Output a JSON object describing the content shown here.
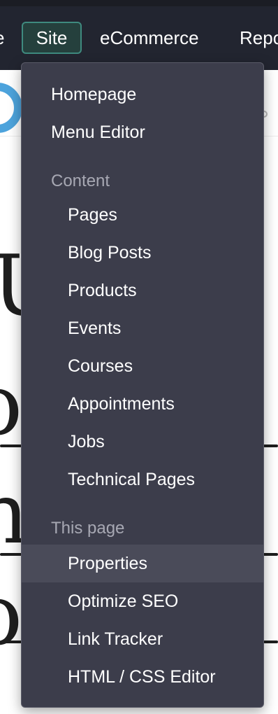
{
  "topnav": {
    "items": [
      "e",
      "Site",
      "eCommerce",
      "Repo"
    ],
    "active": "Site"
  },
  "background": {
    "lines": [
      "Ur",
      "oc",
      "n",
      "oc"
    ]
  },
  "menu": {
    "top_items": [
      "Homepage",
      "Menu Editor"
    ],
    "content_header": "Content",
    "content_items": [
      "Pages",
      "Blog Posts",
      "Products",
      "Events",
      "Courses",
      "Appointments",
      "Jobs",
      "Technical Pages"
    ],
    "this_page_header": "This page",
    "this_page_items": [
      "Properties",
      "Optimize SEO",
      "Link Tracker",
      "HTML / CSS Editor"
    ],
    "highlighted": "Properties"
  },
  "colors": {
    "nav_bg": "#222530",
    "menu_bg": "#3c3d4b",
    "active_nav_border": "#3f8a7f",
    "highlight_bg": "#4a4b59"
  }
}
